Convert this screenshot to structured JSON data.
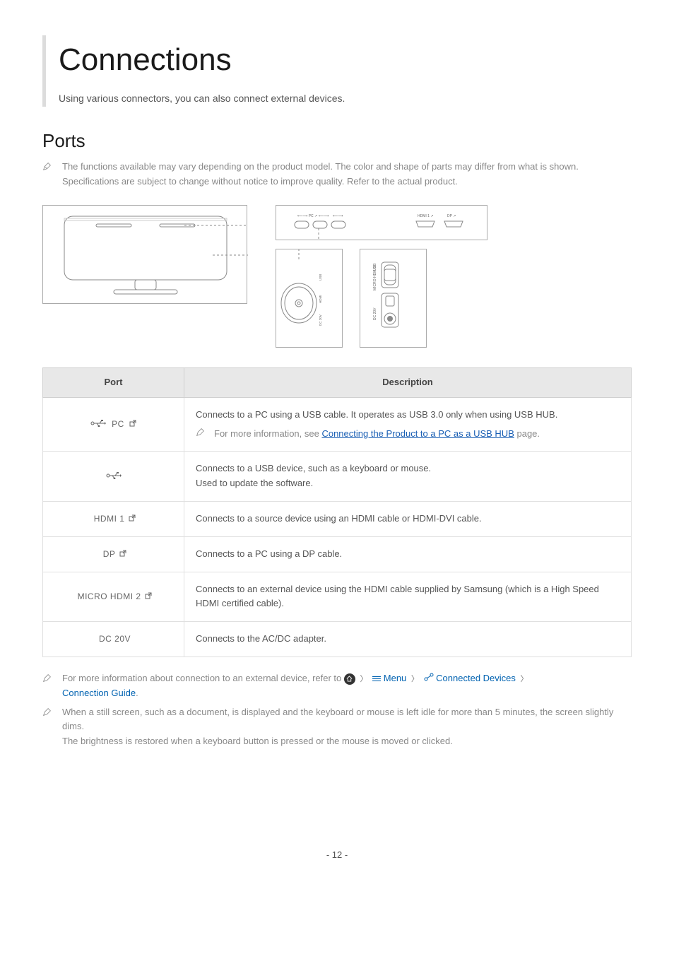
{
  "title": "Connections",
  "subtitle": "Using various connectors, you can also connect external devices.",
  "section_heading": "Ports",
  "intro_note": "The functions available may vary depending on the product model. The color and shape of parts may differ from what is shown. Specifications are subject to change without notice to improve quality. Refer to the actual product.",
  "table": {
    "headers": {
      "port": "Port",
      "description": "Description"
    },
    "rows": [
      {
        "port_label": "PC",
        "port_icon": "usb-pc",
        "desc": "Connects to a PC using a USB cable. It operates as USB 3.0 only when using USB HUB.",
        "sub_note_prefix": "For more information, see ",
        "sub_note_link": "Connecting the Product to a PC as a USB HUB",
        "sub_note_suffix": " page."
      },
      {
        "port_label": "",
        "port_icon": "usb",
        "desc": "Connects to a USB device, such as a keyboard or mouse.",
        "desc2": "Used to update the software."
      },
      {
        "port_label": "HDMI 1",
        "port_icon": "hdmi1",
        "desc": "Connects to a source device using an HDMI cable or HDMI-DVI cable."
      },
      {
        "port_label": "DP",
        "port_icon": "dp",
        "desc": "Connects to a PC using a DP cable."
      },
      {
        "port_label": "MICRO HDMI 2",
        "port_icon": "micro-hdmi",
        "desc": "Connects to an external device using the HDMI cable supplied by Samsung (which is a High Speed HDMI certified cable)."
      },
      {
        "port_label": "DC 20V",
        "port_icon": "dc",
        "desc": "Connects to the AC/DC adapter."
      }
    ]
  },
  "footer_notes": {
    "note1_prefix": "For more information about connection to an external device, refer to ",
    "note1_nav": {
      "menu": "Menu",
      "devices": "Connected Devices",
      "guide": "Connection Guide"
    },
    "note1_suffix": ".",
    "note2_line1": "When a still screen, such as a document, is displayed and the keyboard or mouse is left idle for more than 5 minutes, the screen slightly dims.",
    "note2_line2": "The brightness is restored when a keyboard button is pressed or the mouse is moved or clicked."
  },
  "diagram_labels": {
    "usb_pc": "PC",
    "hdmi1": "HDMI 1",
    "dp": "DP",
    "micro_hdmi2": "MICRO HDMI 2",
    "dc20v": "DC 20V"
  },
  "page_number": "- 12 -"
}
